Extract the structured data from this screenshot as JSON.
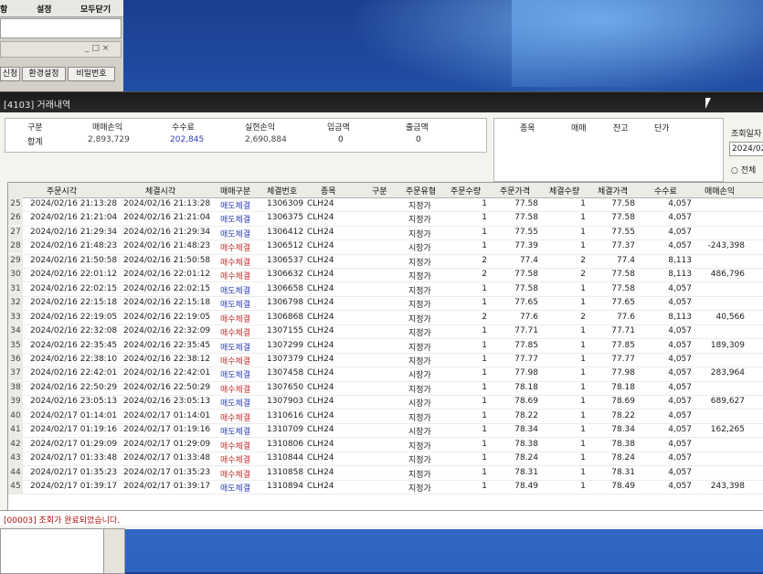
{
  "bg_app": {
    "toolbar": [
      "항",
      "설정",
      "모두닫기"
    ],
    "panel_controls": "_ □ ×",
    "buttons": [
      "신청",
      "환경설정",
      "비밀번호"
    ]
  },
  "window": {
    "title": "[4103] 거래내역"
  },
  "summary": {
    "headers": [
      "구분",
      "매매손익",
      "수수료",
      "실현손익",
      "입금액",
      "출금액"
    ],
    "values": [
      "합계",
      "2,893,729",
      "202,845",
      "2,690,884",
      "0",
      "0"
    ]
  },
  "right_panel": {
    "headers": [
      "종목",
      "매매",
      "잔고",
      "단가"
    ]
  },
  "query": {
    "date_label": "조회일자",
    "date_value": "2024/02/",
    "all_option": "전체"
  },
  "grid": {
    "columns": [
      "주문시각",
      "체결시각",
      "매매구분",
      "체결번호",
      "종목",
      "구분",
      "주문유형",
      "주문수량",
      "주문가격",
      "체결수량",
      "체결가격",
      "수수료",
      "매매손익"
    ],
    "rows": [
      {
        "n": "25",
        "order_time": "2024/02/16 21:13:28",
        "fill_time": "2024/02/16 21:13:28",
        "side": "매도체결",
        "fill_no": "1306309",
        "symbol": "CLH24",
        "type": "지정가",
        "oqty": "1",
        "oprice": "77.58",
        "fqty": "1",
        "fprice": "77.58",
        "fee": "4,057",
        "pnl": ""
      },
      {
        "n": "26",
        "order_time": "2024/02/16 21:21:04",
        "fill_time": "2024/02/16 21:21:04",
        "side": "매도체결",
        "fill_no": "1306375",
        "symbol": "CLH24",
        "type": "지정가",
        "oqty": "1",
        "oprice": "77.58",
        "fqty": "1",
        "fprice": "77.58",
        "fee": "4,057",
        "pnl": ""
      },
      {
        "n": "27",
        "order_time": "2024/02/16 21:29:34",
        "fill_time": "2024/02/16 21:29:34",
        "side": "매도체결",
        "fill_no": "1306412",
        "symbol": "CLH24",
        "type": "지정가",
        "oqty": "1",
        "oprice": "77.55",
        "fqty": "1",
        "fprice": "77.55",
        "fee": "4,057",
        "pnl": ""
      },
      {
        "n": "28",
        "order_time": "2024/02/16 21:48:23",
        "fill_time": "2024/02/16 21:48:23",
        "side": "매수체결",
        "fill_no": "1306512",
        "symbol": "CLH24",
        "type": "시장가",
        "oqty": "1",
        "oprice": "77.39",
        "fqty": "1",
        "fprice": "77.37",
        "fee": "4,057",
        "pnl": "-243,398"
      },
      {
        "n": "29",
        "order_time": "2024/02/16 21:50:58",
        "fill_time": "2024/02/16 21:50:58",
        "side": "매수체결",
        "fill_no": "1306537",
        "symbol": "CLH24",
        "type": "지정가",
        "oqty": "2",
        "oprice": "77.4",
        "fqty": "2",
        "fprice": "77.4",
        "fee": "8,113",
        "pnl": ""
      },
      {
        "n": "30",
        "order_time": "2024/02/16 22:01:12",
        "fill_time": "2024/02/16 22:01:12",
        "side": "매수체결",
        "fill_no": "1306632",
        "symbol": "CLH24",
        "type": "지정가",
        "oqty": "2",
        "oprice": "77.58",
        "fqty": "2",
        "fprice": "77.58",
        "fee": "8,113",
        "pnl": "486,796"
      },
      {
        "n": "31",
        "order_time": "2024/02/16 22:02:15",
        "fill_time": "2024/02/16 22:02:15",
        "side": "매도체결",
        "fill_no": "1306658",
        "symbol": "CLH24",
        "type": "지정가",
        "oqty": "1",
        "oprice": "77.58",
        "fqty": "1",
        "fprice": "77.58",
        "fee": "4,057",
        "pnl": ""
      },
      {
        "n": "32",
        "order_time": "2024/02/16 22:15:18",
        "fill_time": "2024/02/16 22:15:18",
        "side": "매도체결",
        "fill_no": "1306798",
        "symbol": "CLH24",
        "type": "지정가",
        "oqty": "1",
        "oprice": "77.65",
        "fqty": "1",
        "fprice": "77.65",
        "fee": "4,057",
        "pnl": ""
      },
      {
        "n": "33",
        "order_time": "2024/02/16 22:19:05",
        "fill_time": "2024/02/16 22:19:05",
        "side": "매수체결",
        "fill_no": "1306868",
        "symbol": "CLH24",
        "type": "지정가",
        "oqty": "2",
        "oprice": "77.6",
        "fqty": "2",
        "fprice": "77.6",
        "fee": "8,113",
        "pnl": "40,566"
      },
      {
        "n": "34",
        "order_time": "2024/02/16 22:32:08",
        "fill_time": "2024/02/16 22:32:09",
        "side": "매수체결",
        "fill_no": "1307155",
        "symbol": "CLH24",
        "type": "지정가",
        "oqty": "1",
        "oprice": "77.71",
        "fqty": "1",
        "fprice": "77.71",
        "fee": "4,057",
        "pnl": ""
      },
      {
        "n": "35",
        "order_time": "2024/02/16 22:35:45",
        "fill_time": "2024/02/16 22:35:45",
        "side": "매도체결",
        "fill_no": "1307299",
        "symbol": "CLH24",
        "type": "지정가",
        "oqty": "1",
        "oprice": "77.85",
        "fqty": "1",
        "fprice": "77.85",
        "fee": "4,057",
        "pnl": "189,309"
      },
      {
        "n": "36",
        "order_time": "2024/02/16 22:38:10",
        "fill_time": "2024/02/16 22:38:12",
        "side": "매수체결",
        "fill_no": "1307379",
        "symbol": "CLH24",
        "type": "지정가",
        "oqty": "1",
        "oprice": "77.77",
        "fqty": "1",
        "fprice": "77.77",
        "fee": "4,057",
        "pnl": ""
      },
      {
        "n": "37",
        "order_time": "2024/02/16 22:42:01",
        "fill_time": "2024/02/16 22:42:01",
        "side": "매도체결",
        "fill_no": "1307458",
        "symbol": "CLH24",
        "type": "시장가",
        "oqty": "1",
        "oprice": "77.98",
        "fqty": "1",
        "fprice": "77.98",
        "fee": "4,057",
        "pnl": "283,964"
      },
      {
        "n": "38",
        "order_time": "2024/02/16 22:50:29",
        "fill_time": "2024/02/16 22:50:29",
        "side": "매수체결",
        "fill_no": "1307650",
        "symbol": "CLH24",
        "type": "지정가",
        "oqty": "1",
        "oprice": "78.18",
        "fqty": "1",
        "fprice": "78.18",
        "fee": "4,057",
        "pnl": ""
      },
      {
        "n": "39",
        "order_time": "2024/02/16 23:05:13",
        "fill_time": "2024/02/16 23:05:13",
        "side": "매도체결",
        "fill_no": "1307903",
        "symbol": "CLH24",
        "type": "시장가",
        "oqty": "1",
        "oprice": "78.69",
        "fqty": "1",
        "fprice": "78.69",
        "fee": "4,057",
        "pnl": "689,627"
      },
      {
        "n": "40",
        "order_time": "2024/02/17 01:14:01",
        "fill_time": "2024/02/17 01:14:01",
        "side": "매수체결",
        "fill_no": "1310616",
        "symbol": "CLH24",
        "type": "지정가",
        "oqty": "1",
        "oprice": "78.22",
        "fqty": "1",
        "fprice": "78.22",
        "fee": "4,057",
        "pnl": ""
      },
      {
        "n": "41",
        "order_time": "2024/02/17 01:19:16",
        "fill_time": "2024/02/17 01:19:16",
        "side": "매도체결",
        "fill_no": "1310709",
        "symbol": "CLH24",
        "type": "시장가",
        "oqty": "1",
        "oprice": "78.34",
        "fqty": "1",
        "fprice": "78.34",
        "fee": "4,057",
        "pnl": "162,265"
      },
      {
        "n": "42",
        "order_time": "2024/02/17 01:29:09",
        "fill_time": "2024/02/17 01:29:09",
        "side": "매수체결",
        "fill_no": "1310806",
        "symbol": "CLH24",
        "type": "지정가",
        "oqty": "1",
        "oprice": "78.38",
        "fqty": "1",
        "fprice": "78.38",
        "fee": "4,057",
        "pnl": ""
      },
      {
        "n": "43",
        "order_time": "2024/02/17 01:33:48",
        "fill_time": "2024/02/17 01:33:48",
        "side": "매수체결",
        "fill_no": "1310844",
        "symbol": "CLH24",
        "type": "지정가",
        "oqty": "1",
        "oprice": "78.24",
        "fqty": "1",
        "fprice": "78.24",
        "fee": "4,057",
        "pnl": ""
      },
      {
        "n": "44",
        "order_time": "2024/02/17 01:35:23",
        "fill_time": "2024/02/17 01:35:23",
        "side": "매수체결",
        "fill_no": "1310858",
        "symbol": "CLH24",
        "type": "지정가",
        "oqty": "1",
        "oprice": "78.31",
        "fqty": "1",
        "fprice": "78.31",
        "fee": "4,057",
        "pnl": ""
      },
      {
        "n": "45",
        "order_time": "2024/02/17 01:39:17",
        "fill_time": "2024/02/17 01:39:17",
        "side": "매도체결",
        "fill_no": "1310894",
        "symbol": "CLH24",
        "type": "지정가",
        "oqty": "1",
        "oprice": "78.49",
        "fqty": "1",
        "fprice": "78.49",
        "fee": "4,057",
        "pnl": "243,398"
      }
    ]
  },
  "status": "[00003] 조회가 완료되었습니다.",
  "colors": {
    "buy": "#c03030",
    "sell": "#2b3fb3",
    "status": "#b21010"
  }
}
